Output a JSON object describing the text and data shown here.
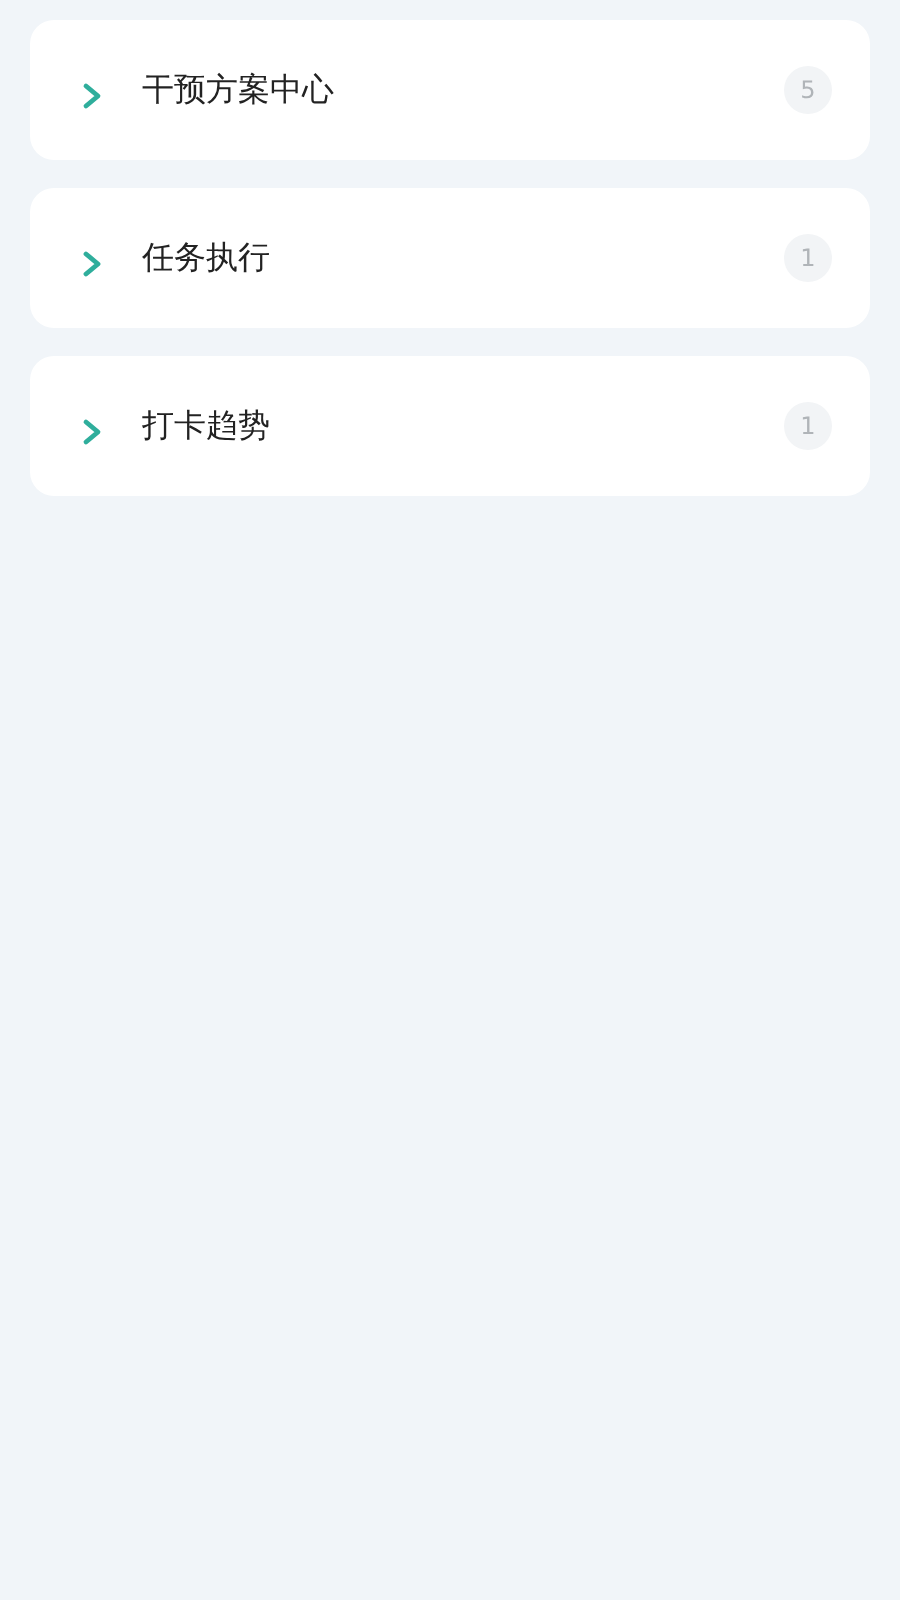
{
  "sections": [
    {
      "title": "干预方案中心",
      "count": "5",
      "expanded": false
    },
    {
      "title": "任务执行",
      "count": "1",
      "expanded": false
    },
    {
      "title": "打卡趋势",
      "count": "1",
      "expanded": false
    }
  ]
}
